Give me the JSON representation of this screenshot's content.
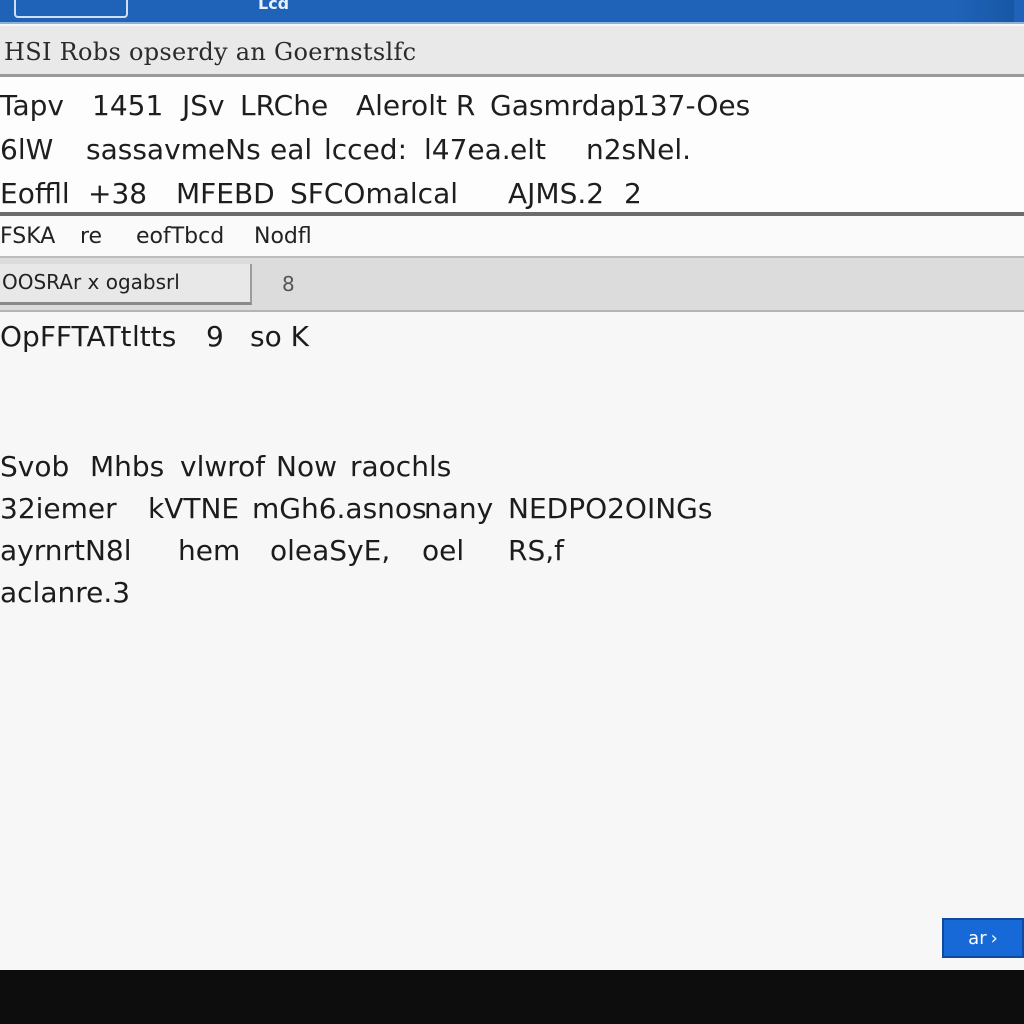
{
  "window": {
    "title_fragment": "Lcd",
    "title_icon": "window-icon"
  },
  "header": {
    "title": "HSI Robs opserdy an Goernstslfc"
  },
  "info": {
    "row1": [
      "Tapv",
      "1451",
      "JSv",
      "LRChe",
      "Alerolt R",
      "Gasmrdap",
      "137-Oes"
    ],
    "row2": [
      "6lW",
      "sassavmeNs",
      "eal",
      "lcced:",
      "l47ea.",
      "elt",
      "n2sNel."
    ],
    "row3": [
      "Eoffll",
      "+38",
      "MFEBD",
      "SFCOmalcal",
      "AJMS.2",
      "2"
    ]
  },
  "toolbar": {
    "items": [
      "FSKA",
      "re",
      "eofTbcd",
      "Nodfl"
    ]
  },
  "tabs": {
    "active_label": "OOSRAr x ogabsrl",
    "handle": "8"
  },
  "content": {
    "line1": [
      "OpFFTATt",
      "ltts",
      "9",
      "so K"
    ],
    "line2": [
      "Svob",
      "Mhbs",
      "vlwrof",
      "Now",
      "raochls"
    ],
    "line3": [
      "32iemer",
      "kVTNE",
      "mGh6.asnos",
      "nany",
      "NEDPO2OINGs"
    ],
    "line4": [
      "ayrnrtN8l",
      "hem",
      "oleaSyE,",
      "oel",
      "RS,f"
    ],
    "line5": [
      "aclanre.3"
    ]
  },
  "action_button": {
    "label": "ar",
    "icon": "chevron-icon"
  },
  "colors": {
    "title_blue": "#1f63b8",
    "button_blue": "#1669d6",
    "panel_bg": "#f7f7f7"
  }
}
